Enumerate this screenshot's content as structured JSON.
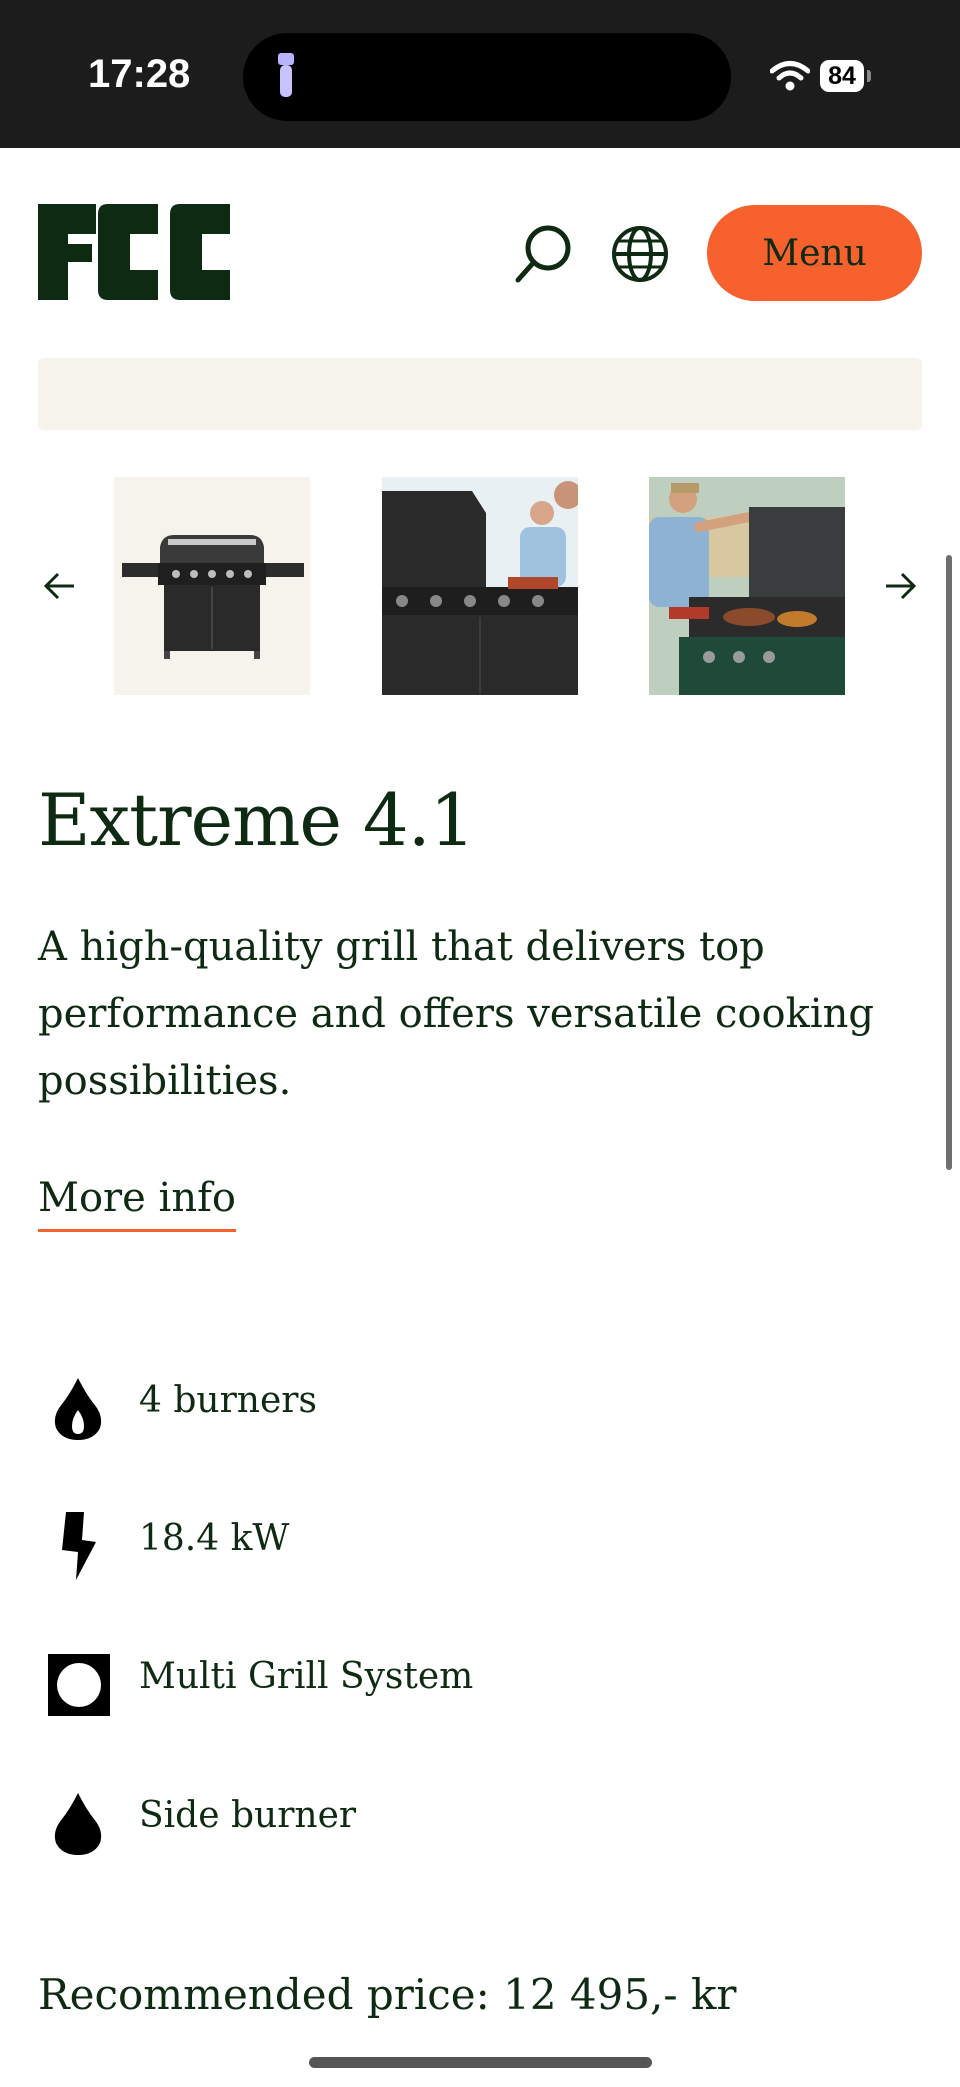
{
  "status_bar": {
    "time": "17:28",
    "battery": "84"
  },
  "header": {
    "logo_text": "FCC",
    "menu_label": "Menu"
  },
  "gallery": {
    "images": [
      "grill-product-shot",
      "people-grilling-1",
      "people-grilling-2"
    ]
  },
  "product": {
    "title": "Extreme 4.1",
    "description": "A high-quality grill that delivers top performance and offers versatile cooking possibilities.",
    "more_info": "More info",
    "features": [
      {
        "icon": "flame-icon",
        "label": "4 burners"
      },
      {
        "icon": "lightning-icon",
        "label": "18.4 kW"
      },
      {
        "icon": "multi-grill-icon",
        "label": "Multi Grill System"
      },
      {
        "icon": "drop-flame-icon",
        "label": "Side burner"
      }
    ],
    "price": "Recommended price: 12 495,- kr"
  },
  "colors": {
    "brand_green": "#0f2a12",
    "accent_orange": "#f6612e",
    "banner_bg": "#f5f3ec"
  }
}
